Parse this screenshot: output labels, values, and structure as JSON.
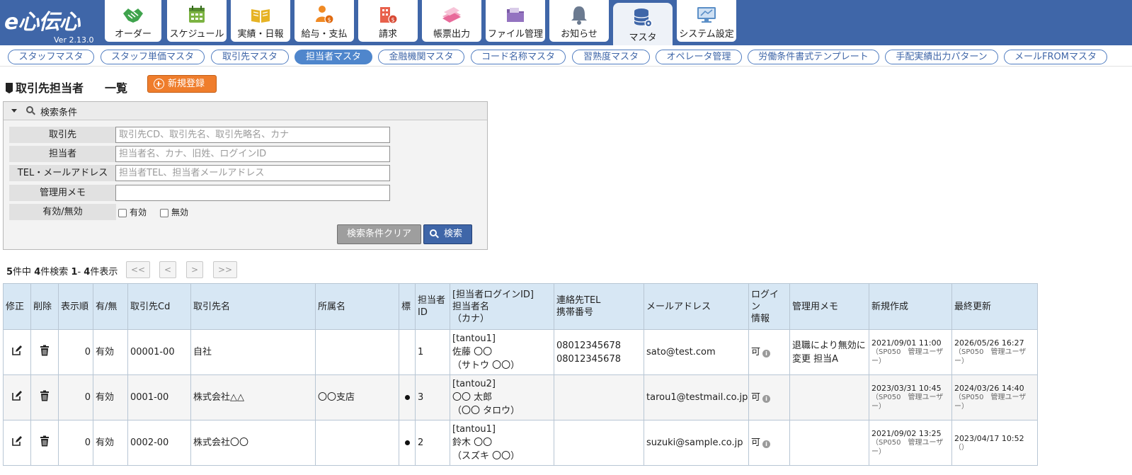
{
  "app": {
    "logo_text": "e心伝心",
    "version": "Ver 2.13.0"
  },
  "nav": [
    {
      "label": "オーダー",
      "icon": "handshake-icon",
      "color": "#3fa34d"
    },
    {
      "label": "スケジュール",
      "icon": "calendar-icon",
      "color": "#7cb342"
    },
    {
      "label": "実績・日報",
      "icon": "book-icon",
      "color": "#e6b325"
    },
    {
      "label": "給与・支払",
      "icon": "person-coin-icon",
      "color": "#f08a24"
    },
    {
      "label": "請求",
      "icon": "building-coin-icon",
      "color": "#e8614c"
    },
    {
      "label": "帳票出力",
      "icon": "papers-icon",
      "color": "#e86a9a"
    },
    {
      "label": "ファイル管理",
      "icon": "folder-icon",
      "color": "#7b5aa6"
    },
    {
      "label": "お知らせ",
      "icon": "bell-icon",
      "color": "#6b7a90"
    },
    {
      "label": "マスタ",
      "icon": "database-gear-icon",
      "color": "#3f66a8"
    },
    {
      "label": "システム設定",
      "icon": "monitor-settings-icon",
      "color": "#5b8fc7"
    }
  ],
  "subnav": [
    "スタッフマスタ",
    "スタッフ単価マスタ",
    "取引先マスタ",
    "担当者マスタ",
    "金融機関マスタ",
    "コード名称マスタ",
    "習熟度マスタ",
    "オペレータ管理",
    "労働条件書式テンプレート",
    "手配実績出力パターン",
    "メールFROMマスタ"
  ],
  "page": {
    "title": "取引先担当者",
    "title_sub": "一覧",
    "new_button": "新規登録"
  },
  "search": {
    "header": "検索条件",
    "fields": [
      {
        "label": "取引先",
        "placeholder": "取引先CD、取引先名、取引先略名、カナ",
        "value": ""
      },
      {
        "label": "担当者",
        "placeholder": "担当者名、カナ、旧姓、ログインID",
        "value": ""
      },
      {
        "label": "TEL・メールアドレス",
        "placeholder": "担当者TEL、担当者メールアドレス",
        "value": ""
      },
      {
        "label": "管理用メモ",
        "placeholder": "",
        "value": ""
      }
    ],
    "status_label": "有効/無効",
    "opt_valid": "有効",
    "opt_invalid": "無効",
    "clear_button": "検索条件クリア",
    "search_button": "検索"
  },
  "pager": {
    "total": "5",
    "total_suffix": "件中",
    "found": "4",
    "found_suffix": "件検索",
    "range_from": "1",
    "range_to": "4",
    "range_suffix": "件表示",
    "first": "<<",
    "prev": "<",
    "next": ">",
    "last": ">>"
  },
  "table": {
    "headers": {
      "edit": "修正",
      "delete": "削除",
      "order": "表示順",
      "valid": "有/無",
      "client_cd": "取引先Cd",
      "client_name": "取引先名",
      "dept": "所属名",
      "mark": "標",
      "staff_id_1": "担当者",
      "staff_id_2": "ID",
      "login_1": "[担当者ログインID]",
      "login_2": "担当者名",
      "login_3": "（カナ）",
      "tel_1": "連絡先TEL",
      "tel_2": "携帯番号",
      "email": "メールアドレス",
      "login_info_1": "ログイン",
      "login_info_2": "情報",
      "memo": "管理用メモ",
      "created": "新規作成",
      "updated": "最終更新"
    },
    "rows": [
      {
        "order": "0",
        "valid": "有効",
        "client_cd": "00001-00",
        "client_name": "自社",
        "dept": "",
        "mark": "",
        "staff_id": "1",
        "login_id": "[tantou1]",
        "name": "佐藤 〇〇",
        "kana": "（サトウ 〇〇）",
        "tel": "08012345678",
        "mobile": "08012345678",
        "email": "sato@test.com",
        "login_info": "可",
        "memo": "退職により無効に変更 担当A",
        "created": "2021/09/01 11:00",
        "created_by": "（SP050　管理ユーザー）",
        "updated": "2026/05/26 16:27",
        "updated_by": "（SP050　管理ユーザー）"
      },
      {
        "order": "0",
        "valid": "有効",
        "client_cd": "0001-00",
        "client_name": "株式会社△△",
        "dept": "〇〇支店",
        "mark": "●",
        "staff_id": "3",
        "login_id": "[tantou2]",
        "name": "〇〇 太郎",
        "kana": "（〇〇 タロウ）",
        "tel": "",
        "mobile": "",
        "email": "tarou1@testmail.co.jp",
        "login_info": "可",
        "memo": "",
        "created": "2023/03/31 10:45",
        "created_by": "（SP050　管理ユーザー）",
        "updated": "2024/03/26 14:40",
        "updated_by": "（SP050　管理ユーザー）"
      },
      {
        "order": "0",
        "valid": "有効",
        "client_cd": "0002-00",
        "client_name": "株式会社〇〇",
        "dept": "",
        "mark": "●",
        "staff_id": "2",
        "login_id": "[tantou1]",
        "name": "鈴木 〇〇",
        "kana": "（スズキ 〇〇）",
        "tel": "",
        "mobile": "",
        "email": "suzuki@sample.co.jp",
        "login_info": "可",
        "memo": "",
        "created": "2021/09/02 13:25",
        "created_by": "（SP050　管理ユーザー）",
        "updated": "2023/04/17 10:52",
        "updated_by": "（）"
      }
    ]
  }
}
